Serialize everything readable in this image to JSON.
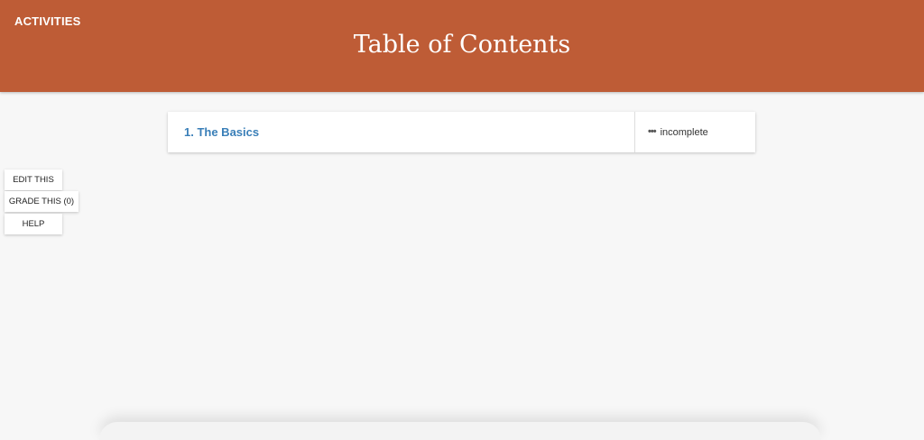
{
  "header": {
    "activities_label": "ACTIVITIES",
    "title": "Table of Contents",
    "color": "#be5c36"
  },
  "toc": {
    "items": [
      {
        "label": "1. The Basics",
        "status": "incomplete",
        "status_icon": "dots-icon"
      }
    ],
    "link_color": "#3a7fb8"
  },
  "side_buttons": {
    "edit_label": "EDIT THIS",
    "grade_label": "GRADE THIS (0)",
    "help_label": "HELP"
  }
}
